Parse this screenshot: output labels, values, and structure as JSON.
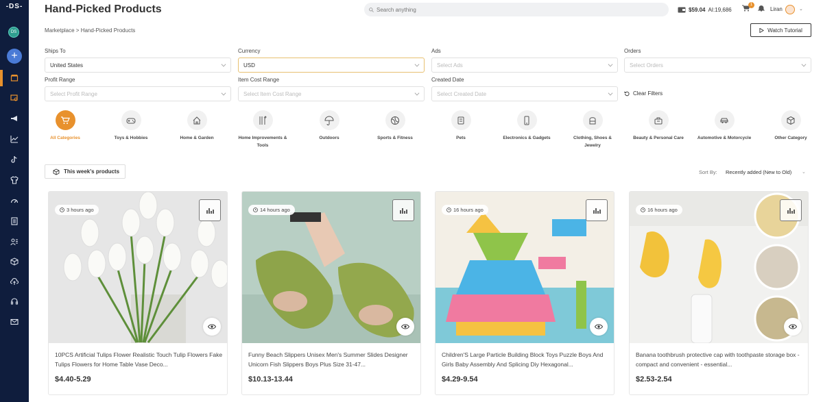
{
  "sidebar": {
    "logo": "-DS-",
    "avatar_initials": "DS",
    "items": [
      {
        "icon": "store-icon"
      },
      {
        "icon": "product-search-icon"
      },
      {
        "icon": "megaphone-icon"
      },
      {
        "icon": "chart-line-icon"
      },
      {
        "icon": "tiktok-icon"
      },
      {
        "icon": "shirt-icon"
      },
      {
        "icon": "gauge-icon"
      },
      {
        "icon": "document-icon"
      },
      {
        "icon": "user-list-icon"
      },
      {
        "icon": "box-icon"
      },
      {
        "icon": "cloud-upload-icon"
      },
      {
        "icon": "headset-icon"
      },
      {
        "icon": "mail-icon"
      }
    ]
  },
  "header": {
    "title": "Hand-Picked Products",
    "search_placeholder": "Search anything",
    "balance": "$59.04",
    "ai_credits": "AI:19,686",
    "cart_count": "1",
    "user_name": "Liran"
  },
  "breadcrumb": "Marketplace > Hand-Picked Products",
  "watch_tutorial": "Watch Tutorial",
  "filters": {
    "ships_to": {
      "label": "Ships To",
      "value": "United States"
    },
    "currency": {
      "label": "Currency",
      "value": "USD"
    },
    "ads": {
      "label": "Ads",
      "placeholder": "Select Ads"
    },
    "orders": {
      "label": "Orders",
      "placeholder": "Select Orders"
    },
    "profit_range": {
      "label": "Profit Range",
      "placeholder": "Select Profit Range"
    },
    "item_cost_range": {
      "label": "Item Cost Range",
      "placeholder": "Select Item Cost Range"
    },
    "created_date": {
      "label": "Created Date",
      "placeholder": "Select Created Date"
    },
    "clear_filters": "Clear Filters"
  },
  "categories": [
    {
      "label": "All Categories",
      "icon": "cart-icon",
      "active": true
    },
    {
      "label": "Toys & Hobbies",
      "icon": "gamepad-icon"
    },
    {
      "label": "Home & Garden",
      "icon": "house-icon"
    },
    {
      "label": "Home Improvements & Tools",
      "icon": "tools-icon"
    },
    {
      "label": "Outdoors",
      "icon": "umbrella-icon"
    },
    {
      "label": "Sports & Fitness",
      "icon": "ball-icon"
    },
    {
      "label": "Pets",
      "icon": "pet-food-icon"
    },
    {
      "label": "Electronics & Gadgets",
      "icon": "phone-icon"
    },
    {
      "label": "Clothing, Shoes & Jewelry",
      "icon": "hat-icon"
    },
    {
      "label": "Beauty & Personal Care",
      "icon": "cosmetic-bag-icon"
    },
    {
      "label": "Automotive & Motorcycle",
      "icon": "car-icon"
    },
    {
      "label": "Other Category",
      "icon": "cube-icon"
    }
  ],
  "this_week": "This week's products",
  "sort": {
    "label": "Sort By:",
    "value": "Recently added (New to Old)"
  },
  "products": [
    {
      "time": "3 hours ago",
      "title": "10PCS Artificial Tulips Flower Realistic Touch Tulip Flowers Fake Tulips Flowers for Home Table Vase Deco...",
      "price": "$4.40-5.29"
    },
    {
      "time": "14 hours ago",
      "title": "Funny Beach Slippers Unisex Men's Summer Slides Designer Unicorn Fish Slippers Boys Plus Size 31-47...",
      "price": "$10.13-13.44"
    },
    {
      "time": "16 hours ago",
      "title": "Children'S Large Particle Building Block Toys Puzzle Boys And Girls Baby Assembly And Splicing Diy Hexagonal...",
      "price": "$4.29-9.54"
    },
    {
      "time": "16 hours ago",
      "title": "Banana toothbrush protective cap with toothpaste storage box - compact and convenient - essential...",
      "price": "$2.53-2.54"
    }
  ]
}
